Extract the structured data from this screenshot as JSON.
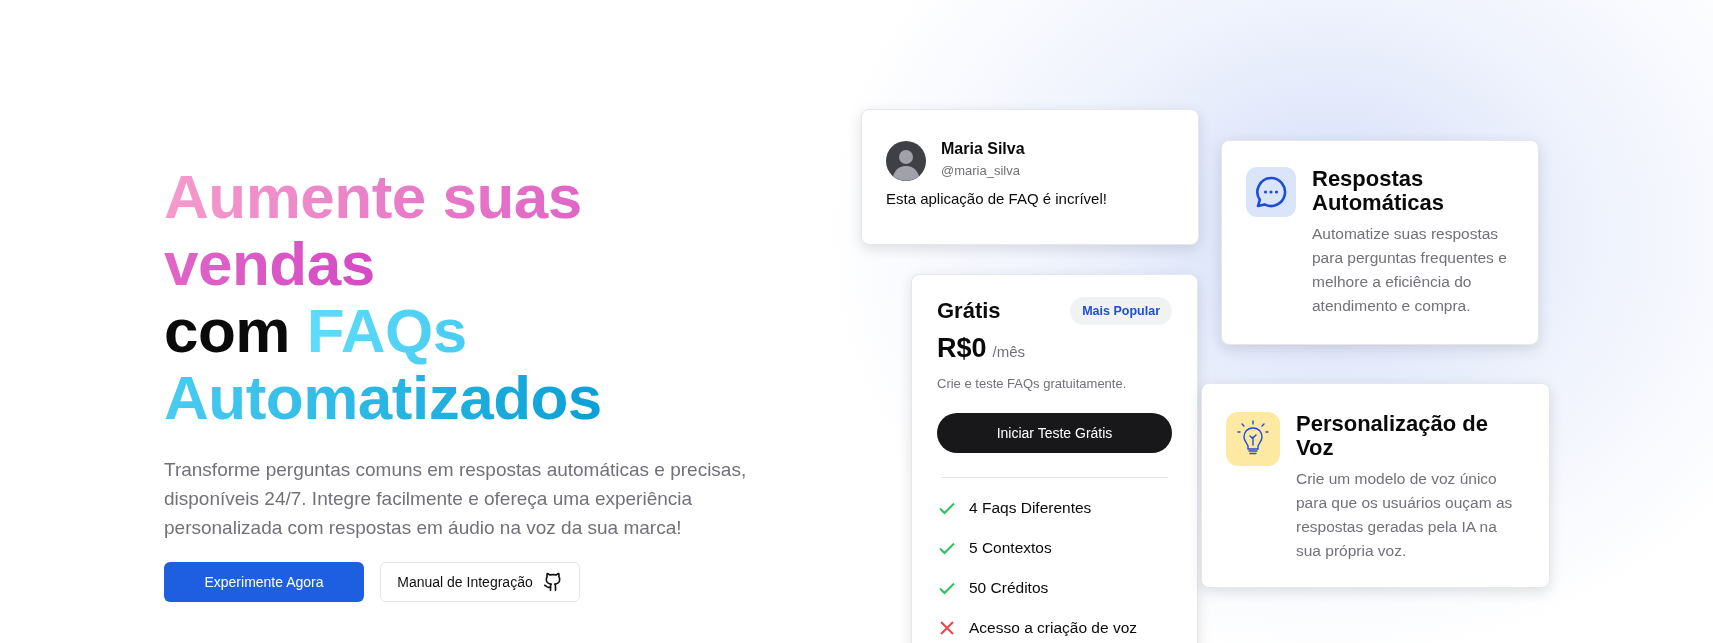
{
  "hero": {
    "headline": {
      "gradient_text": "Aumente suas vendas",
      "plain_text": "com",
      "highlight_text": "FAQs Automatizados"
    },
    "description": "Transforme perguntas comuns em respostas automáticas e precisas, disponíveis 24/7. Integre facilmente e ofereça uma experiência personalizada com respostas em áudio na voz da sua marca!",
    "buttons": [
      {
        "label": "Experimente Agora",
        "kind": "primary"
      },
      {
        "label": "Manual de Integração",
        "kind": "github"
      }
    ]
  },
  "testimonial": {
    "name": "Maria Silva",
    "handle": "@maria_silva",
    "text": "Esta aplicação de FAQ é incrível!"
  },
  "pricing": {
    "plan": "Grátis",
    "badge": "Mais Popular",
    "price": "R$0",
    "period": "/mês",
    "description": "Crie e teste FAQs gratuitamente.",
    "button": "Iniciar Teste Grátis",
    "features": [
      {
        "label": "4 Faqs Diferentes",
        "included": true
      },
      {
        "label": "5 Contextos",
        "included": true
      },
      {
        "label": "50 Créditos",
        "included": true
      },
      {
        "label": "Acesso a criação de voz",
        "included": false
      }
    ]
  },
  "feature_cards": [
    {
      "kind": "chat",
      "title": "Respostas Automáticas",
      "description": "Automatize suas respostas para perguntas frequentes e melhore a eficiência do atendimento e compra."
    },
    {
      "kind": "idea",
      "title": "Personalização de Voz",
      "description": "Crie um modelo de voz único para que os usuários ouçam as respostas geradas pela IA na sua própria voz."
    }
  ]
}
